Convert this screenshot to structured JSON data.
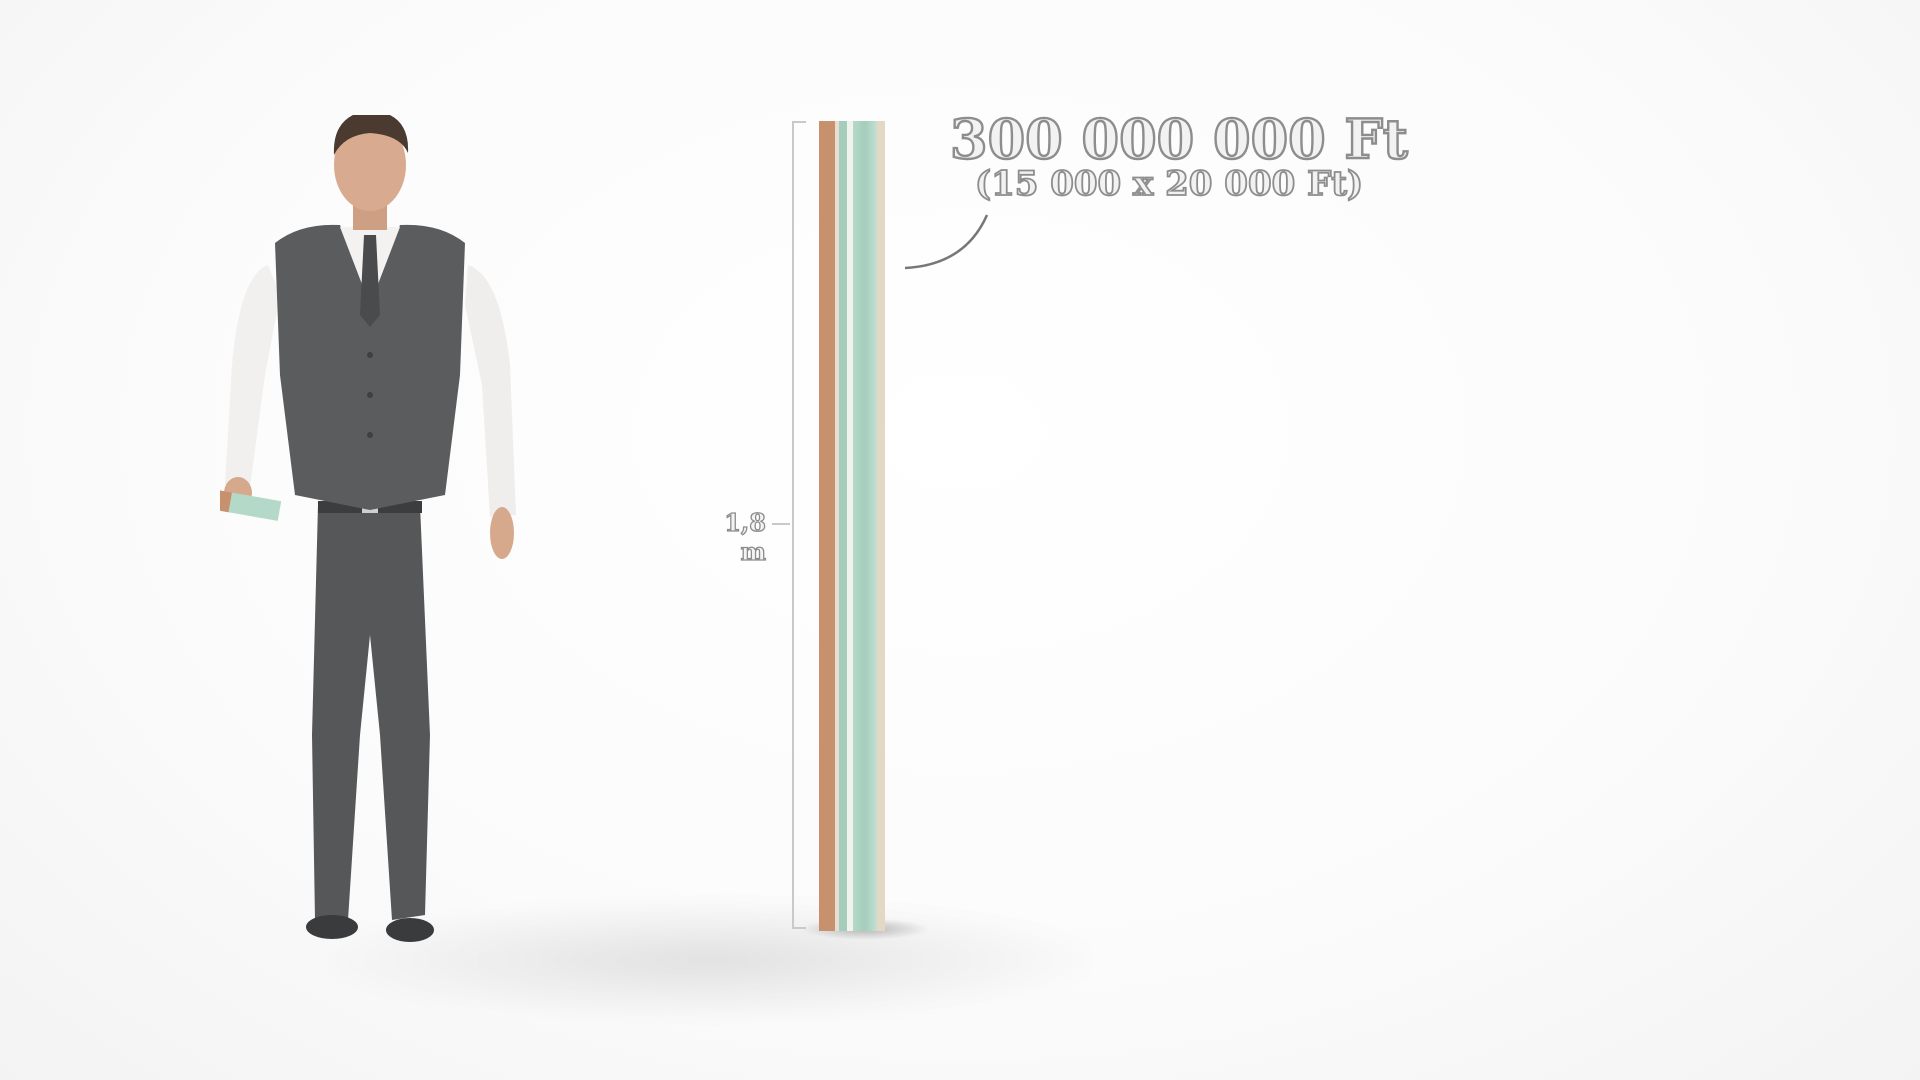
{
  "scene": {
    "measure": {
      "label": "1,8 m"
    },
    "annotation": {
      "amount": "300 000 000 Ft",
      "breakdown": "(15 000 x 20 000 Ft)"
    },
    "colors": {
      "background": "#fdfdfd",
      "banknote_brown": "#c7916d",
      "banknote_green": "#a5cdbc",
      "label_outline": "#8d8d8d"
    }
  }
}
